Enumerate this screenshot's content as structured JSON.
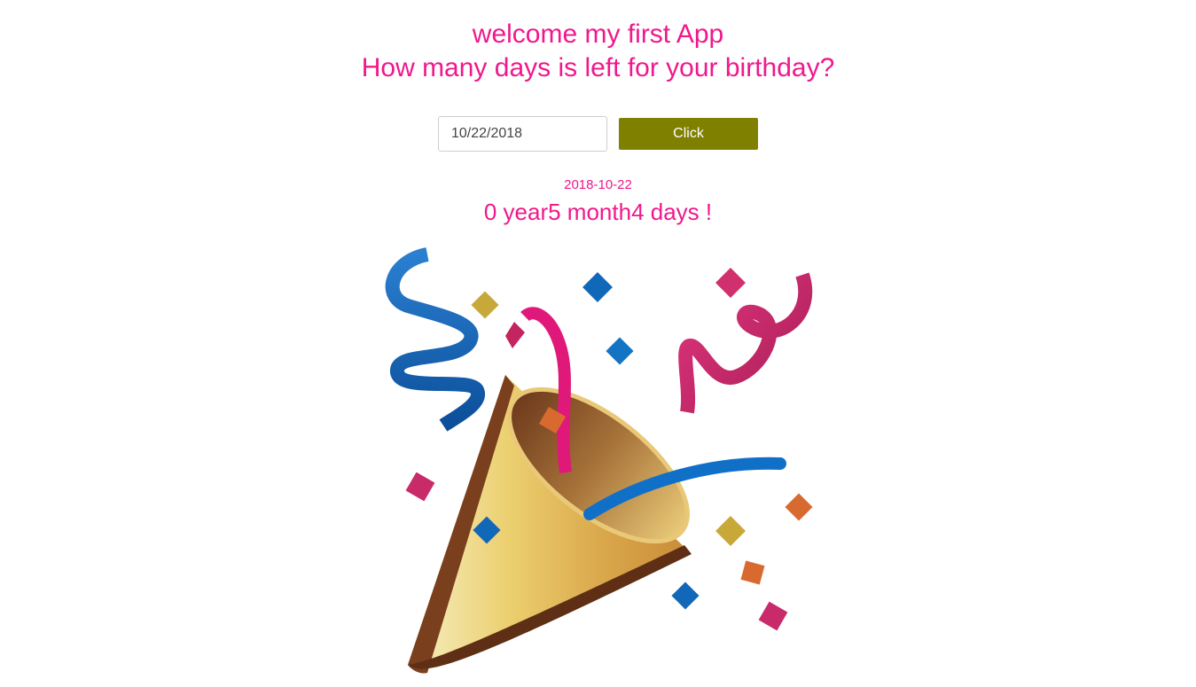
{
  "header": {
    "title": "welcome my first App",
    "subtitle": "How many days is left for your birthday?"
  },
  "form": {
    "date_value": "10/22/2018",
    "button_label": "Click"
  },
  "result": {
    "date": "2018-10-22",
    "countdown": "0 year5 month4 days !"
  },
  "colors": {
    "accent": "#f0188c",
    "button": "#808000"
  },
  "image": {
    "icon": "party-popper-icon"
  }
}
